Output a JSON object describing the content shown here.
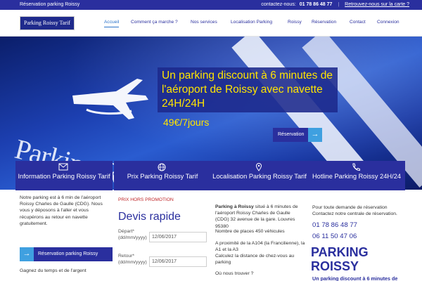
{
  "topbar": {
    "left": "Réservation parking Roissy",
    "contact_label": "contactez-nous:",
    "phone": "01 78 86 48 77",
    "map_link": "Retrouvez-nous sur la carte ?"
  },
  "logo": {
    "text": "Parking Roissy Tarif"
  },
  "nav": {
    "items": [
      "Accueil",
      "Comment ça marche ?",
      "Nos services",
      "Localisation Parking",
      "Roissy",
      "Réservation",
      "Contact",
      "Connexion"
    ],
    "active": "Accueil"
  },
  "hero": {
    "sign_text": "Parking Roissy Tarif",
    "headline": "Un parking discount à 6 minutes de l'aéroport de Roissy avec navette 24H/24H",
    "price": "49€/7jours",
    "cta_label": "Réservation"
  },
  "colors": {
    "brand": "#2a2f9e",
    "accent": "#3fa0e0",
    "headline": "#ffe400",
    "promo": "#c0282a"
  },
  "cards": [
    {
      "title": "Information Parking Roissy Tarif",
      "icon": "envelope-icon",
      "text": "Notre parking est à 6 min de l'aéroport Roissy Charles de Gaulle (CDG). Nous vous y déposons à l'aller et vous récupérons au retour en navette gratuitement.",
      "button": "Réservation parking Roissy",
      "footer": "Gagnez du temps et de l'argent"
    },
    {
      "title": "Prix Parking Roissy Tarif",
      "icon": "globe-icon",
      "promo": "PRIX HORS PROMOTION",
      "form_title": "Devis rapide",
      "depart_label": "Départ*",
      "depart_format": "(dd/mm/yyyy)",
      "depart_value": "12/06/2017",
      "retour_label": "Retour*",
      "retour_format": "(dd/mm/yyyy)",
      "retour_value": "12/06/2017"
    },
    {
      "title": "Localisation Parking Roissy Tarif",
      "icon": "map-pin-icon",
      "name": "Parking à Roissy",
      "address": "situé à 6 minutes de l'aéroport Roissy Charles de Gaulle (CDG) 32 avenue de la gare. Louvres 95380",
      "places": "Nombre de places 450 véhicules",
      "proximity": "A proximité de la A104 (la Francilienne), la A1 et la A3",
      "distance_link": "Calculez la distance de chez-vous au parking",
      "where": "Où nous trouver ?"
    },
    {
      "title": "Hotline Parking Roissy 24H/24",
      "icon": "phone-icon",
      "text": "Pour toute demande de réservation Contactez notre centrale de réservation.",
      "phone1": "01 78 86 48 77",
      "phone2": "06 11 50 47 06",
      "brand": "PARKING ROISSY",
      "tagline": "Un parking discount à 6 minutes de"
    }
  ]
}
